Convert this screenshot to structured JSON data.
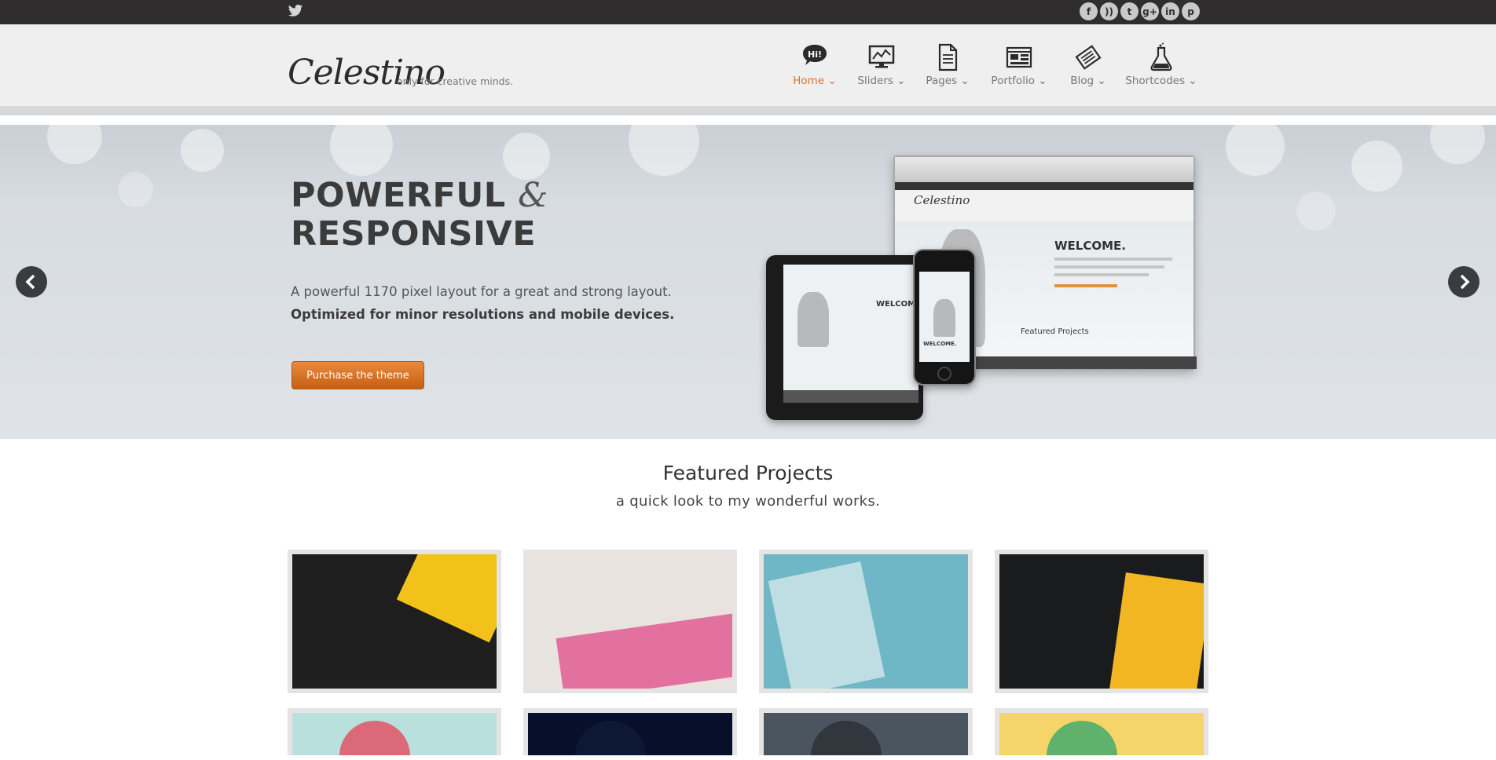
{
  "topbar": {
    "twitter_icon": "twitter-icon",
    "social": [
      {
        "name": "facebook-icon",
        "glyph": "f"
      },
      {
        "name": "rss-icon",
        "glyph": "))"
      },
      {
        "name": "twitter-icon",
        "glyph": "t"
      },
      {
        "name": "googleplus-icon",
        "glyph": "g+"
      },
      {
        "name": "linkedin-icon",
        "glyph": "in"
      },
      {
        "name": "pinterest-icon",
        "glyph": "p"
      }
    ]
  },
  "header": {
    "logo": "Celestino",
    "tagline": "only for creative minds.",
    "nav": [
      {
        "label": "Home",
        "icon": "hi-bubble-icon",
        "active": true
      },
      {
        "label": "Sliders",
        "icon": "monitor-chart-icon"
      },
      {
        "label": "Pages",
        "icon": "document-icon"
      },
      {
        "label": "Portfolio",
        "icon": "layout-grid-icon"
      },
      {
        "label": "Blog",
        "icon": "newspaper-icon"
      },
      {
        "label": "Shortcodes",
        "icon": "flask-icon"
      }
    ],
    "chevron": "⌄"
  },
  "hero": {
    "title_line1": "POWERFUL",
    "title_amp": "&",
    "title_line2": "RESPONSIVE",
    "text_line1": "A powerful 1170 pixel layout for a great and strong layout.",
    "text_line2": "Optimized for minor resolutions and mobile devices.",
    "cta_label": "Purchase the theme",
    "mock_welcome": "WELCOME.",
    "mock_logo": "Celestino",
    "mock_featured": "Featured Projects"
  },
  "featured": {
    "title": "Featured Projects",
    "subtitle": "a quick look to my wonderful works.",
    "items": [
      {
        "name": "project-miller-bob-card",
        "bg": "#1e1e1e",
        "accent": "#f2c21b"
      },
      {
        "name": "project-pink-pattern-card",
        "bg": "#e9e3df",
        "accent": "#e0548e"
      },
      {
        "name": "project-nil-studios-card",
        "bg": "#6fb7c6",
        "accent": "#dfeef1"
      },
      {
        "name": "project-digitpool-card",
        "bg": "#1a1b1d",
        "accent": "#f3b623"
      },
      {
        "name": "project-octopus-mug",
        "bg": "#b9e0dc",
        "accent": "#e34b5e"
      },
      {
        "name": "project-dark-navy",
        "bg": "#07102a",
        "accent": "#0e1a3a"
      },
      {
        "name": "project-portrait-hair",
        "bg": "#4a5560",
        "accent": "#2a2f35"
      },
      {
        "name": "project-yellow-illustration",
        "bg": "#f5d56a",
        "accent": "#3aa76b"
      }
    ]
  },
  "colors": {
    "accent": "#d8732a",
    "topbar": "#2f2d2e"
  }
}
